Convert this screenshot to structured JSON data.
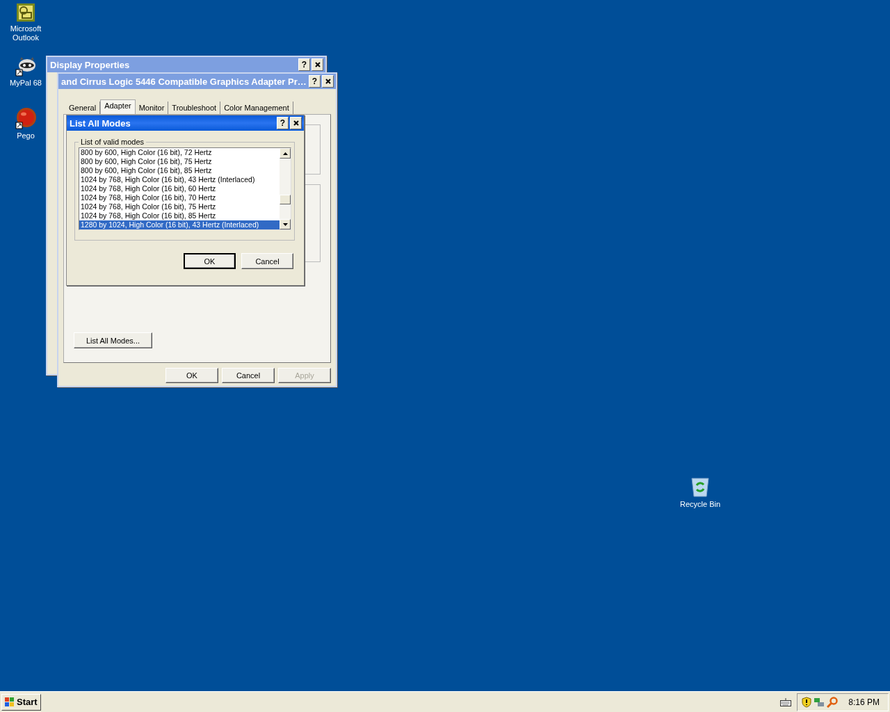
{
  "desktop_icons": [
    {
      "label": "Microsoft Outlook",
      "kind": "outlook"
    },
    {
      "label": "MyPal 68",
      "kind": "mypal"
    },
    {
      "label": "Pego",
      "kind": "pego"
    },
    {
      "label": "Recycle Bin",
      "kind": "recycle"
    }
  ],
  "display_properties": {
    "title": "Display Properties",
    "title_buttons": [
      "?"
    ]
  },
  "adapter_properties": {
    "title": "and Cirrus Logic 5446 Compatible Graphics Adapter Pr…",
    "title_buttons": [
      "?"
    ],
    "tabs": [
      {
        "label": "General",
        "selected": false
      },
      {
        "label": "Adapter",
        "selected": true
      },
      {
        "label": "Monitor",
        "selected": false
      },
      {
        "label": "Troubleshoot",
        "selected": false
      },
      {
        "label": "Color Management",
        "selected": false
      }
    ],
    "list_all_modes_button": "List All Modes...",
    "buttons": [
      {
        "label": "OK",
        "disabled": false
      },
      {
        "label": "Cancel",
        "disabled": false
      },
      {
        "label": "Apply",
        "disabled": true
      }
    ]
  },
  "list_all_modes_dialog": {
    "title": "List All Modes",
    "title_buttons": [
      "?"
    ],
    "group_label": "List of valid modes",
    "modes": [
      {
        "label": "800 by 600, High Color (16 bit), 72 Hertz",
        "selected": false
      },
      {
        "label": "800 by 600, High Color (16 bit), 75 Hertz",
        "selected": false
      },
      {
        "label": "800 by 600, High Color (16 bit), 85 Hertz",
        "selected": false
      },
      {
        "label": "1024 by 768, High Color (16 bit), 43 Hertz (Interlaced)",
        "selected": false
      },
      {
        "label": "1024 by 768, High Color (16 bit), 60 Hertz",
        "selected": false
      },
      {
        "label": "1024 by 768, High Color (16 bit), 70 Hertz",
        "selected": false
      },
      {
        "label": "1024 by 768, High Color (16 bit), 75 Hertz",
        "selected": false
      },
      {
        "label": "1024 by 768, High Color (16 bit), 85 Hertz",
        "selected": false
      },
      {
        "label": "1280 by 1024, High Color (16 bit), 43 Hertz (Interlaced)",
        "selected": true
      }
    ],
    "buttons": [
      {
        "label": "OK",
        "default": true
      },
      {
        "label": "Cancel",
        "default": false
      }
    ]
  },
  "taskbar": {
    "start": "Start",
    "clock": "8:16 PM"
  }
}
